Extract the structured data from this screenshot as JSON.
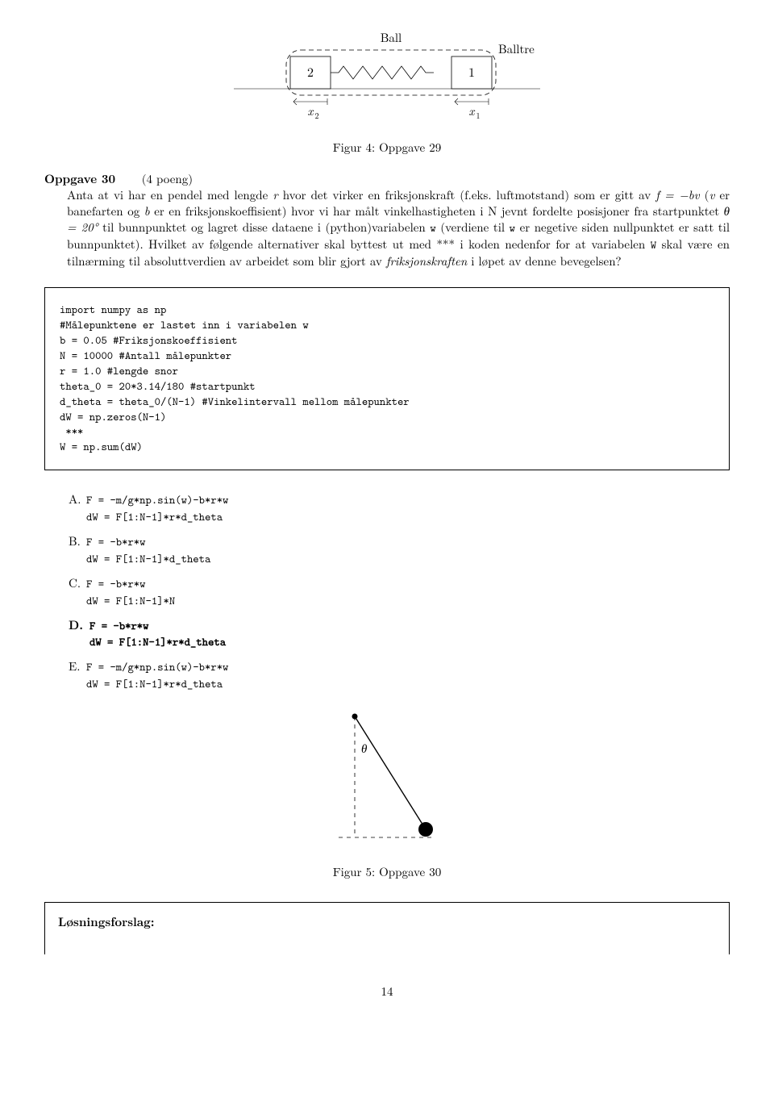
{
  "fig4": {
    "label_ball": "Ball",
    "label_balltre": "Balltre",
    "box_left": "2",
    "box_right": "1",
    "x2": "x",
    "x2_sub": "2",
    "x1": "x",
    "x1_sub": "1",
    "caption": "Figur 4: Oppgave 29"
  },
  "heading": {
    "title": "Oppgave 30",
    "points": "(4 poeng)"
  },
  "paragraph": {
    "p1a": "Anta at vi har en pendel med lengde ",
    "p1b": " hvor det virker en friksjonskraft (f.eks. luftmotstand) som er gitt av ",
    "p1c": " (",
    "p1d": " er banefarten og ",
    "p1e": " er en friksjonskoeffisient) hvor vi har målt vinkelhastigheten i N jevnt fordelte posisjoner fra startpunktet ",
    "p1f": " til bunnpunktet og lagret disse dataene i (python)variabelen ",
    "p1g": " (verdiene til ",
    "p1h": " er negetive siden nullpunktet er satt til bunnpunktet). Hvilket av følgende alternativer skal byttest ut med *** i koden nedenfor for at variabelen ",
    "p1i": " skal være en tilnærming til absoluttverdien av arbeidet som blir gjort av ",
    "p1j": " i løpet av denne bevegelsen?",
    "var_r": "r",
    "eq_f": "f = −bv",
    "var_v": "v",
    "var_b": "b",
    "eq_theta": "θ = 20°",
    "var_w": "w",
    "var_w2": "w",
    "var_W": "W",
    "friksjon": "friksjonskraften"
  },
  "code": "import numpy as np\n#Målepunktene er lastet inn i variabelen w\nb = 0.05 #Friksjonskoeffisient\nN = 10000 #Antall målepunkter\nr = 1.0 #lengde snor\ntheta_0 = 20*3.14/180 #startpunkt\nd_theta = theta_0/(N-1) #Vinkelintervall mellom målepunkter\ndW = np.zeros(N-1)\n ***\nW = np.sum(dW)",
  "options": {
    "A": {
      "label": "A.",
      "l1": "F = -m/g*np.sin(w)-b*r*w",
      "l2": "dW = F[1:N-1]*r*d_theta"
    },
    "B": {
      "label": "B.",
      "l1": "F = -b*r*w",
      "l2": "dW = F[1:N-1]*d_theta"
    },
    "C": {
      "label": "C.",
      "l1": "F = -b*r*w",
      "l2": "dW = F[1:N-1]*N"
    },
    "D": {
      "label": "D.",
      "l1": "F = -b*r*w",
      "l2": "dW = F[1:N-1]*r*d_theta"
    },
    "E": {
      "label": "E.",
      "l1": "F = -m/g*np.sin(w)-b*r*w",
      "l2": "dW = F[1:N-1]*r*d_theta"
    }
  },
  "fig5": {
    "theta": "θ",
    "caption": "Figur 5: Oppgave 30"
  },
  "solution_label": "Løsningsforslag:",
  "page_number": "14"
}
